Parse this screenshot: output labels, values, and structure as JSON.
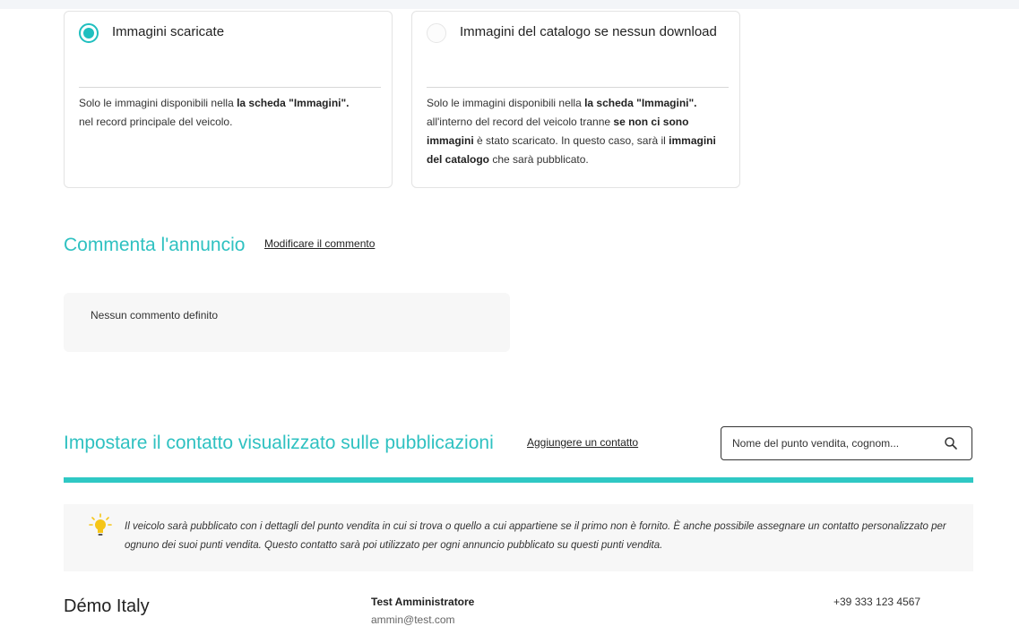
{
  "options": [
    {
      "title": "Immagini scaricate",
      "selected": true,
      "desc": {
        "p1": "Solo le immagini disponibili nella ",
        "b1": "la scheda \"Immagini\".",
        "p2": "nel record principale del veicolo."
      }
    },
    {
      "title": "Immagini del catalogo se nessun download",
      "selected": false,
      "desc": {
        "p1": "Solo le immagini disponibili nella ",
        "b1": "la scheda \"Immagini\".",
        "p2": "all'interno del record del veicolo tranne ",
        "b2": "se non ci sono immagini",
        "p3": " è stato scaricato. In questo caso, sarà il ",
        "b3": "immagini del catalogo",
        "p4": " che sarà pubblicato."
      }
    }
  ],
  "comment_section": {
    "title": "Commenta l'annuncio",
    "link": "Modificare il commento",
    "empty_text": "Nessun commento definito"
  },
  "contact_section": {
    "title": "Impostare il contatto visualizzato sulle pubblicazioni",
    "link": "Aggiungere un contatto",
    "search_text": "Nome del punto vendita, cognom...",
    "info_text": "Il veicolo sarà pubblicato con i dettagli del punto vendita in cui si trova o quello a cui appartiene se il primo non è fornito. È anche possibile assegnare un contatto personalizzato per ognuno dei suoi punti vendita. Questo contatto sarà poi utilizzato per ogni annuncio pubblicato su questi punti vendita."
  },
  "contact_row": {
    "name": "Démo Italy",
    "contact_name": "Test Amministratore",
    "email": "ammin@test.com",
    "phone": "+39 333 123 4567"
  },
  "colors": {
    "accent": "#2fc1c1",
    "bar": "#2fc8c4",
    "bulb": "#f5c518"
  },
  "icons": {
    "search": "search-icon",
    "info": "lightbulb-icon"
  }
}
